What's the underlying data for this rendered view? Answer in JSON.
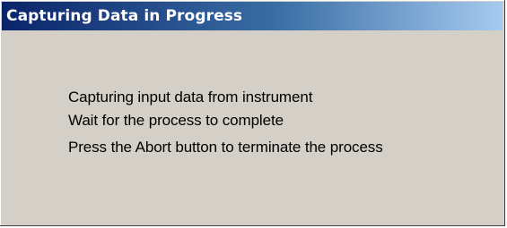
{
  "window": {
    "title": "Capturing Data in Progress"
  },
  "messages": [
    "Capturing input data from instrument",
    "Wait for the process to complete",
    "Press the Abort button to terminate the process"
  ],
  "colors": {
    "title_bar_start": "#0a246a",
    "title_bar_end": "#a6caf0",
    "dialog_background": "#d4d0c8"
  }
}
